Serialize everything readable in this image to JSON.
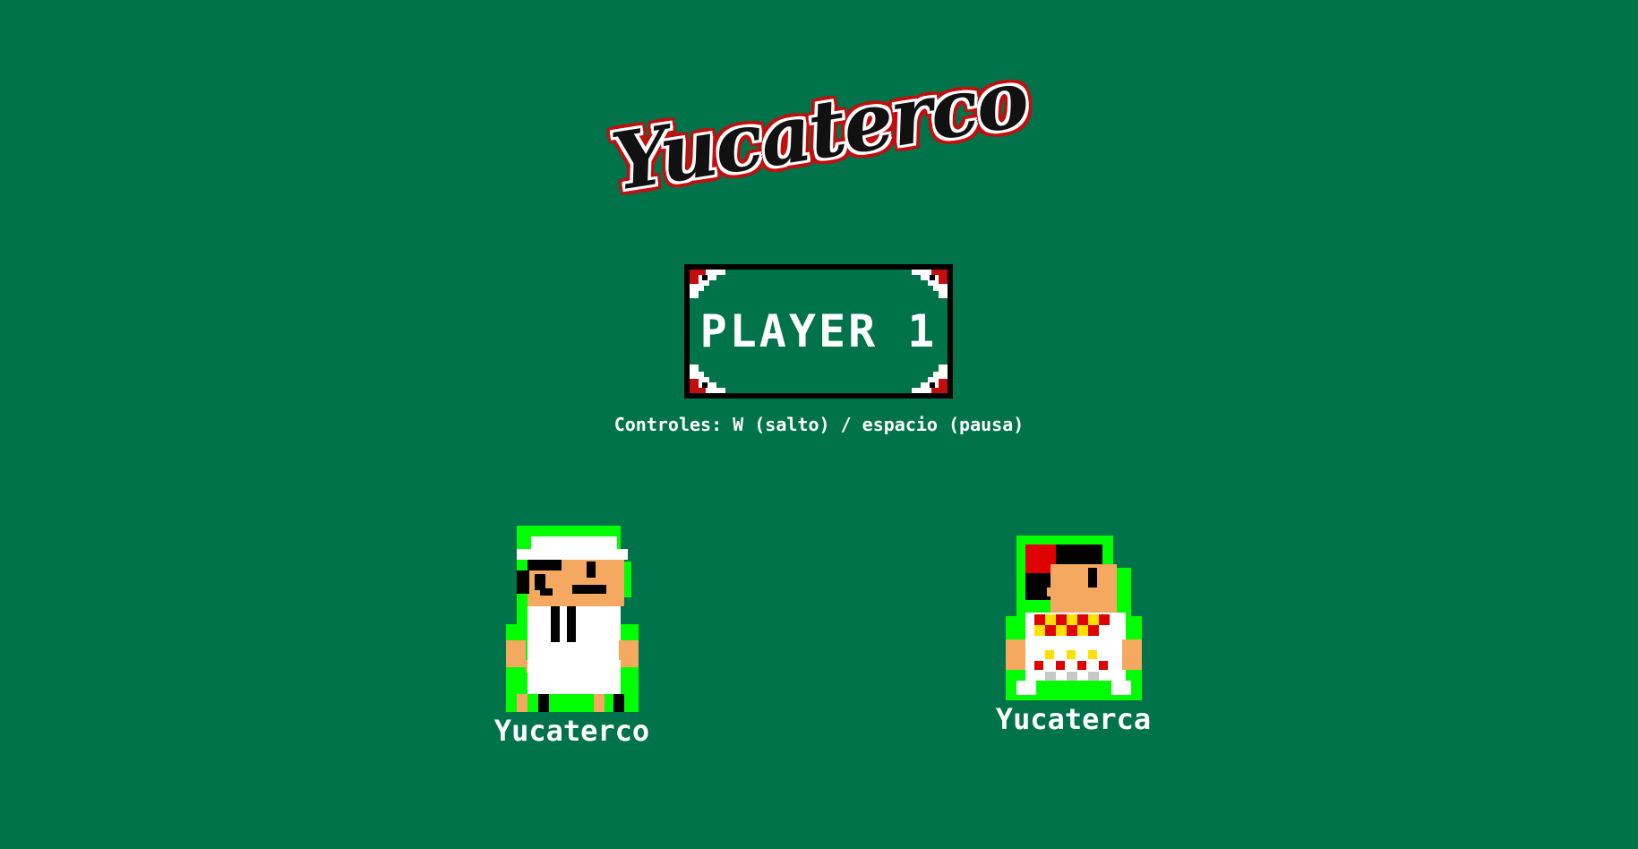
{
  "logo": {
    "text": "Yucaterco",
    "outline_color": "#c60d0d",
    "inner_color": "#ffffff",
    "ink_color": "#111111"
  },
  "start_button": {
    "label": "PLAYER 1",
    "border_color": "#000000",
    "corner_accent_color": "#c60d0d"
  },
  "controls_text": "Controles: W (salto) / espacio (pausa)",
  "characters": [
    {
      "name": "Yucaterco",
      "icon": "yucaterco-sprite-icon"
    },
    {
      "name": "Yucaterca",
      "icon": "yucaterca-sprite-icon"
    }
  ],
  "colors": {
    "background": "#00734b",
    "sprite_glow": "#00ff00",
    "skin": "#f4a860",
    "red": "#e00000",
    "yellow": "#ffe000"
  }
}
